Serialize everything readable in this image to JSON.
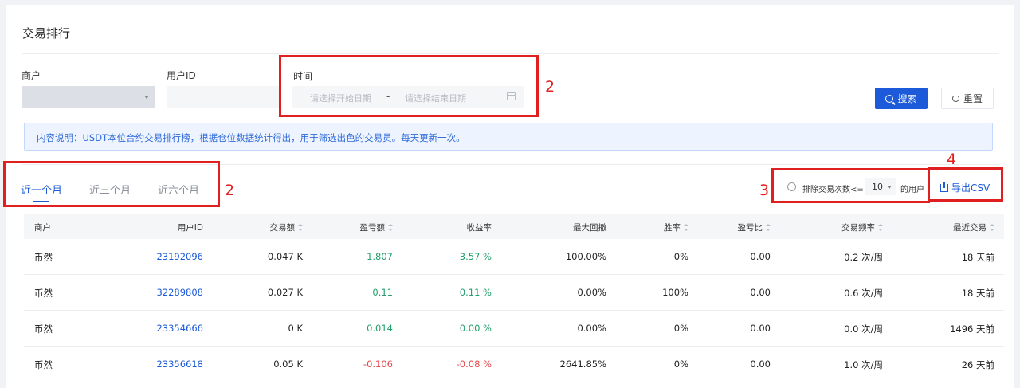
{
  "page": {
    "title": "交易排行"
  },
  "filters": {
    "merchant_label": "商户",
    "merchant_value": "",
    "userid_label": "用户ID",
    "userid_value": "",
    "time_label": "时间",
    "date_start_placeholder": "请选择开始日期",
    "date_separator": "-",
    "date_end_placeholder": "请选择结束日期",
    "search_label": "搜索",
    "reset_label": "重置"
  },
  "info": {
    "text": "内容说明：USDT本位合约交易排行榜，根据仓位数据统计得出，用于筛选出色的交易员。每天更新一次。"
  },
  "tabs": [
    {
      "label": "近一个月",
      "active": true
    },
    {
      "label": "近三个月",
      "active": false
    },
    {
      "label": "近六个月",
      "active": false
    }
  ],
  "exclude": {
    "text": "排除交易次数<=",
    "value": "10",
    "suffix": "的用户"
  },
  "export": {
    "label": "导出CSV"
  },
  "annotations": [
    "2",
    "2",
    "3",
    "4"
  ],
  "table": {
    "columns": [
      {
        "key": "merchant",
        "label": "商户",
        "sortable": false
      },
      {
        "key": "userid",
        "label": "用户ID",
        "sortable": false
      },
      {
        "key": "volume",
        "label": "交易额",
        "sortable": true
      },
      {
        "key": "pnl",
        "label": "盈亏额",
        "sortable": true
      },
      {
        "key": "roi",
        "label": "收益率",
        "sortable": false
      },
      {
        "key": "mdd",
        "label": "最大回撤",
        "sortable": false
      },
      {
        "key": "win",
        "label": "胜率",
        "sortable": true
      },
      {
        "key": "ratio",
        "label": "盈亏比",
        "sortable": true
      },
      {
        "key": "freq",
        "label": "交易频率",
        "sortable": true
      },
      {
        "key": "recent",
        "label": "最近交易",
        "sortable": true
      }
    ],
    "rows": [
      {
        "merchant": "币然",
        "userid": "23192096",
        "volume": "0.047 K",
        "pnl": "1.807",
        "roi": "3.57 %",
        "mdd": "100.00%",
        "win": "0%",
        "ratio": "0.00",
        "freq": "0.2 次/周",
        "recent": "18 天前",
        "tone": "pos"
      },
      {
        "merchant": "币然",
        "userid": "32289808",
        "volume": "0.027 K",
        "pnl": "0.11",
        "roi": "0.11 %",
        "mdd": "0.00%",
        "win": "100%",
        "ratio": "0.00",
        "freq": "0.6 次/周",
        "recent": "18 天前",
        "tone": "pos"
      },
      {
        "merchant": "币然",
        "userid": "23354666",
        "volume": "0 K",
        "pnl": "0.014",
        "roi": "0.00 %",
        "mdd": "0.00%",
        "win": "0%",
        "ratio": "0.00",
        "freq": "0.0 次/周",
        "recent": "1496 天前",
        "tone": "pos"
      },
      {
        "merchant": "币然",
        "userid": "23356618",
        "volume": "0.05 K",
        "pnl": "-0.106",
        "roi": "-0.08 %",
        "mdd": "2641.85%",
        "win": "0%",
        "ratio": "0.00",
        "freq": "1.0 次/周",
        "recent": "26 天前",
        "tone": "neg"
      }
    ]
  },
  "colors": {
    "primary": "#1d5ad9",
    "positive": "#22a06b",
    "negative": "#e5484d",
    "annotation": "#e02020"
  }
}
